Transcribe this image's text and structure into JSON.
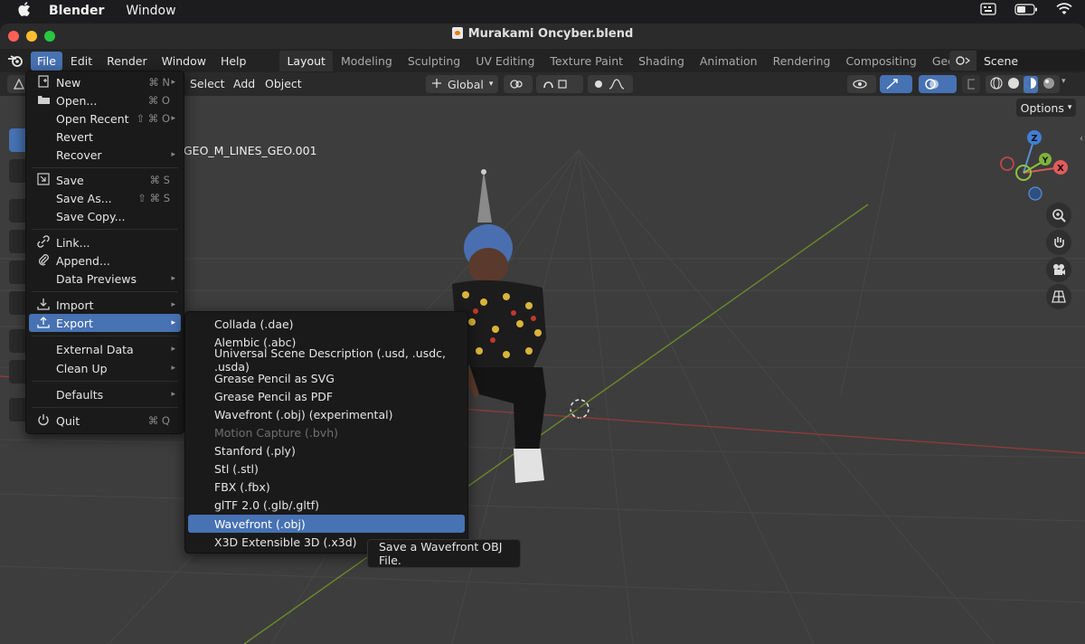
{
  "macbar": {
    "app": "Blender",
    "menu": "Window"
  },
  "window": {
    "title": "Murakami Oncyber.blend"
  },
  "topbar": {
    "menus": [
      "File",
      "Edit",
      "Render",
      "Window",
      "Help"
    ],
    "workspaces": [
      "Layout",
      "Modeling",
      "Sculpting",
      "UV Editing",
      "Texture Paint",
      "Shading",
      "Animation",
      "Rendering",
      "Compositing",
      "Geometry Nodes"
    ],
    "active_workspace": "Layout",
    "scene": "Scene"
  },
  "header": {
    "menus": [
      "Select",
      "Add",
      "Object"
    ],
    "orientation": "Global",
    "options": "Options"
  },
  "viewport": {
    "object_label": "GEO_M_LINES_GEO.001",
    "gizmo_axes": {
      "x": "X",
      "y": "Y",
      "z": "Z"
    }
  },
  "file_menu": {
    "items": [
      {
        "label": "New",
        "shortcut": "⌘ N",
        "submenu": true
      },
      {
        "label": "Open...",
        "shortcut": "⌘ O"
      },
      {
        "label": "Open Recent",
        "shortcut": "⇧ ⌘ O",
        "submenu": true
      },
      {
        "label": "Revert"
      },
      {
        "label": "Recover",
        "submenu": true
      },
      {
        "label": "Save",
        "shortcut": "⌘ S"
      },
      {
        "label": "Save As...",
        "shortcut": "⇧ ⌘ S"
      },
      {
        "label": "Save Copy..."
      },
      {
        "label": "Link..."
      },
      {
        "label": "Append..."
      },
      {
        "label": "Data Previews",
        "submenu": true
      },
      {
        "label": "Import",
        "submenu": true
      },
      {
        "label": "Export",
        "submenu": true
      },
      {
        "label": "External Data",
        "submenu": true
      },
      {
        "label": "Clean Up",
        "submenu": true
      },
      {
        "label": "Defaults",
        "submenu": true
      },
      {
        "label": "Quit",
        "shortcut": "⌘ Q"
      }
    ]
  },
  "export_menu": {
    "items": [
      "Collada (.dae)",
      "Alembic (.abc)",
      "Universal Scene Description (.usd, .usdc, .usda)",
      "Grease Pencil as SVG",
      "Grease Pencil as PDF",
      "Wavefront (.obj) (experimental)",
      "Motion Capture (.bvh)",
      "Stanford (.ply)",
      "Stl (.stl)",
      "FBX (.fbx)",
      "glTF 2.0 (.glb/.gltf)",
      "Wavefront (.obj)",
      "X3D Extensible 3D (.x3d)"
    ]
  },
  "tooltip": "Save a Wavefront OBJ File."
}
